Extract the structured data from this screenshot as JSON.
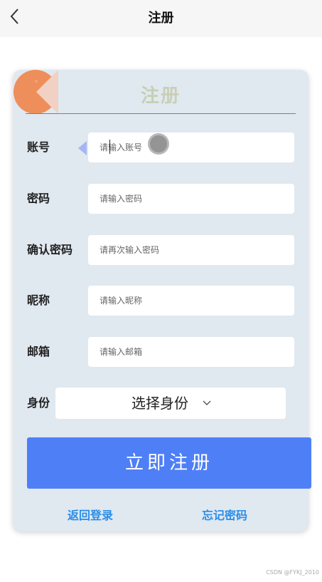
{
  "header": {
    "title": "注册",
    "back_icon": "chevron-left-icon"
  },
  "card": {
    "title": "注册",
    "title_gradient": [
      "#9fd7b0",
      "#f0c7b8"
    ],
    "fields": [
      {
        "label": "账号",
        "placeholder": "请输入账号"
      },
      {
        "label": "密码",
        "placeholder": "请输入密码"
      },
      {
        "label": "确认密码",
        "placeholder": "请再次输入密码"
      },
      {
        "label": "昵称",
        "placeholder": "请输入昵称"
      },
      {
        "label": "邮箱",
        "placeholder": "请输入邮箱"
      }
    ],
    "identity": {
      "label": "身份",
      "select_text": "选择身份"
    },
    "submit_label": "立即注册",
    "back_to_login": "返回登录",
    "forgot_password": "忘记密码"
  },
  "watermark": "CSDN @FYKJ_2010",
  "colors": {
    "primary_button": "#4e7ff6",
    "link": "#2a8de8",
    "card_bg": "#e0e8f0",
    "pac_orange": "#ee8f5b"
  }
}
